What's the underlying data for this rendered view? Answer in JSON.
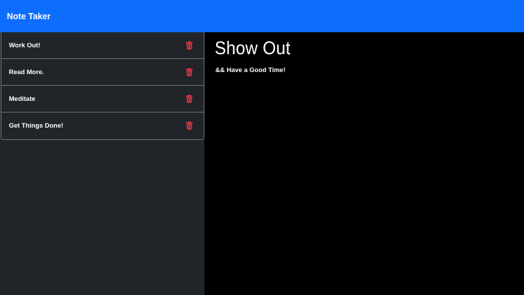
{
  "navbar": {
    "brand": "Note Taker",
    "color": "#0d6efd"
  },
  "notes": [
    {
      "title": "Work Out!",
      "delete_icon": "trash-icon"
    },
    {
      "title": "Read More.",
      "delete_icon": "trash-icon"
    },
    {
      "title": "Meditate",
      "delete_icon": "trash-icon"
    },
    {
      "title": "Get Things Done!",
      "delete_icon": "trash-icon"
    }
  ],
  "active_note": {
    "title": "Show Out",
    "text": "&& Have a Good Time!"
  },
  "colors": {
    "sidebar_bg": "#212529",
    "main_bg": "#000000",
    "delete_icon": "#dc3545"
  }
}
